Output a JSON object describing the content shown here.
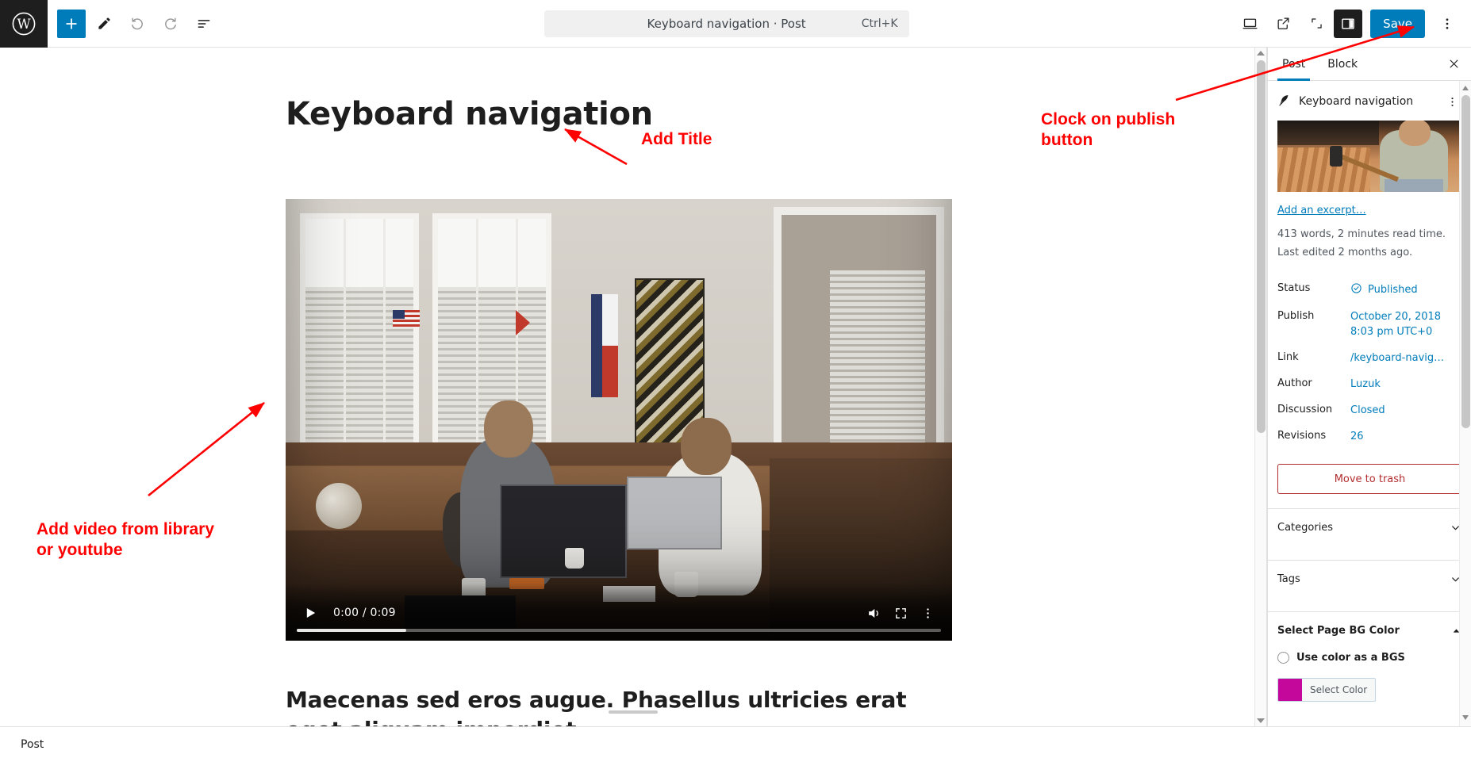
{
  "app": {
    "logo_icon": "wordpress-logo-icon",
    "status_bar_label": "Post"
  },
  "toolbar": {
    "add_block_icon": "plus-icon",
    "tools_icon": "pencil-icon",
    "undo_icon": "undo-arrow-icon",
    "redo_icon": "redo-arrow-icon",
    "list_view_icon": "list-view-icon",
    "command_bar_text": "Keyboard navigation · Post",
    "command_bar_shortcut": "Ctrl+K",
    "preview_icon": "desktop-preview-icon",
    "view_post_icon": "external-link-icon",
    "zoom_out_icon": "zoom-out-icon",
    "settings_toggle_icon": "sidebar-toggle-icon",
    "save_label": "Save",
    "options_icon": "three-dots-vertical-icon"
  },
  "editor": {
    "post_title": "Keyboard navigation",
    "body_heading": "Maecenas sed eros augue. Phasellus ultricies erat eget aliquam imperdiet",
    "video": {
      "play_icon": "play-icon",
      "time_display": "0:00 / 0:09",
      "current_time": "0:00",
      "duration": "0:09",
      "volume_icon": "volume-high-icon",
      "fullscreen_icon": "fullscreen-icon",
      "more_icon": "three-dots-vertical-icon",
      "progress_percent": 17
    }
  },
  "sidebar": {
    "tabs": [
      {
        "label": "Post",
        "active": true
      },
      {
        "label": "Block",
        "active": false
      }
    ],
    "close_icon": "close-icon",
    "post_row": {
      "icon": "feather-quill-icon",
      "title": "Keyboard navigation",
      "menu_icon": "three-dots-vertical-icon"
    },
    "featured_image_alt": "featured-image-thumbnail",
    "excerpt_link": "Add an excerpt…",
    "word_count_text": "413 words, 2 minutes read time.",
    "last_edited_text": "Last edited 2 months ago.",
    "rows": [
      {
        "key": "Status",
        "value": "Published",
        "icon": "check-circle-icon"
      },
      {
        "key": "Publish",
        "value": "October 20, 2018\n8:03 pm UTC+0",
        "icon": ""
      },
      {
        "key": "Link",
        "value": "/keyboard-navig…",
        "icon": ""
      },
      {
        "key": "Author",
        "value": "Luzuk",
        "icon": ""
      },
      {
        "key": "Discussion",
        "value": "Closed",
        "icon": ""
      },
      {
        "key": "Revisions",
        "value": "26",
        "icon": ""
      }
    ],
    "trash_label": "Move to trash",
    "panels": [
      {
        "label": "Categories",
        "expanded": false,
        "chevron": "chevron-down-icon"
      },
      {
        "label": "Tags",
        "expanded": false,
        "chevron": "chevron-down-icon"
      }
    ],
    "bg_panel": {
      "label": "Select Page BG Color",
      "chevron": "chevron-up-icon",
      "radio_label": "Use color as a BGS",
      "radio_checked": false,
      "color_button_label": "Select Color",
      "color_value": "#c4089c"
    }
  },
  "annotations": [
    {
      "text": "Add Title",
      "name": "annotation-add-title"
    },
    {
      "text": "Clock on publish\nbutton",
      "name": "annotation-publish"
    },
    {
      "text": "Add video from library\nor youtube",
      "name": "annotation-video"
    }
  ],
  "colors": {
    "accent": "#007cba",
    "annotation": "#ff0000",
    "danger": "#b32d2e",
    "swatch": "#c4089c"
  }
}
